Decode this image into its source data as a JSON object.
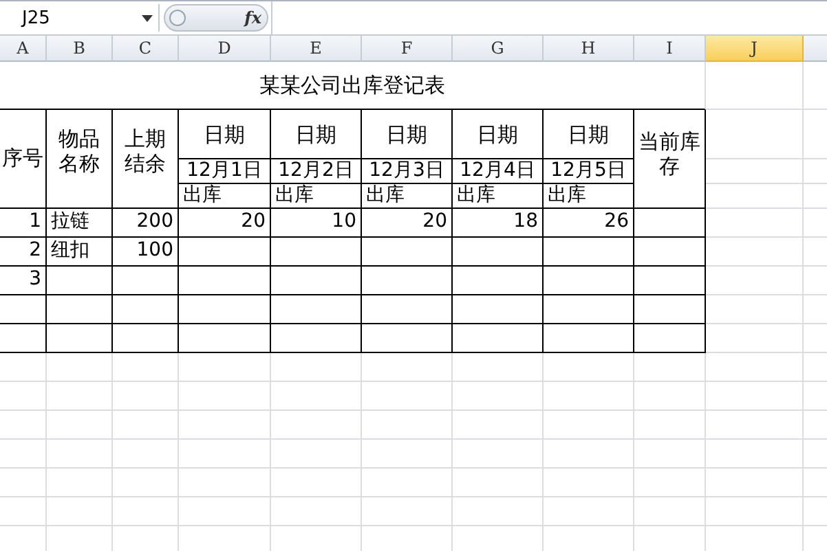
{
  "name_box": {
    "value": "J25"
  },
  "formula_bar": {
    "fx_label": "fx"
  },
  "columns": [
    {
      "label": "A",
      "selected": false
    },
    {
      "label": "B",
      "selected": false
    },
    {
      "label": "C",
      "selected": false
    },
    {
      "label": "D",
      "selected": false
    },
    {
      "label": "E",
      "selected": false
    },
    {
      "label": "F",
      "selected": false
    },
    {
      "label": "G",
      "selected": false
    },
    {
      "label": "H",
      "selected": false
    },
    {
      "label": "I",
      "selected": false
    },
    {
      "label": "J",
      "selected": true
    }
  ],
  "sheet": {
    "title": "某某公司出库登记表",
    "header": {
      "seq": "序号",
      "item": "物品名称",
      "previous": "上期结余",
      "current": "当前库存",
      "dates": [
        {
          "label": "日期",
          "date": "12月1日",
          "sub": "出库"
        },
        {
          "label": "日期",
          "date": "12月2日",
          "sub": "出库"
        },
        {
          "label": "日期",
          "date": "12月3日",
          "sub": "出库"
        },
        {
          "label": "日期",
          "date": "12月4日",
          "sub": "出库"
        },
        {
          "label": "日期",
          "date": "12月5日",
          "sub": "出库"
        }
      ]
    },
    "rows": [
      {
        "seq": "1",
        "item": "拉链",
        "previous": "200",
        "out": [
          "20",
          "10",
          "20",
          "18",
          "26"
        ]
      },
      {
        "seq": "2",
        "item": "纽扣",
        "previous": "100"
      },
      {
        "seq": "3"
      },
      {},
      {}
    ]
  }
}
